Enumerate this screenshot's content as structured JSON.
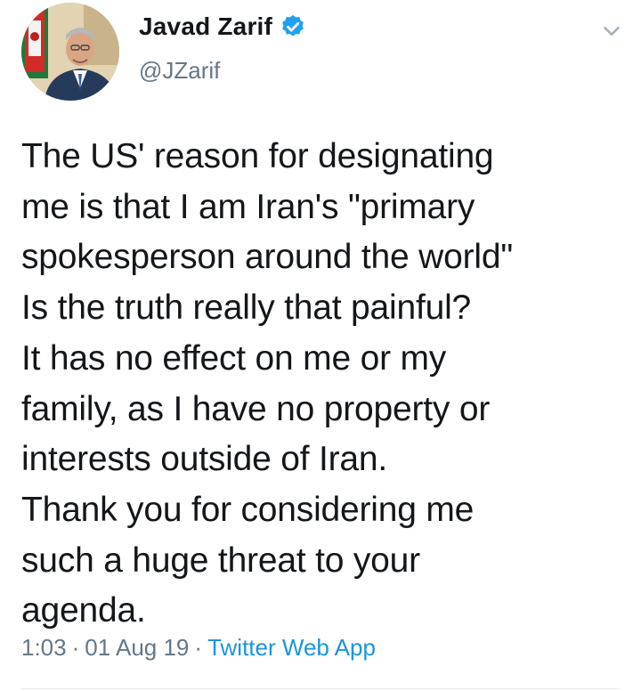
{
  "author": {
    "display_name": "Javad Zarif",
    "handle": "@JZarif",
    "verified": true
  },
  "tweet": {
    "text": "The US' reason for designating\nme is that I am Iran's \"primary\nspokesperson around the world\"\nIs the truth really that painful?\nIt has no effect on me or my\nfamily, as I have no property or\ninterests outside of Iran.\nThank you for considering me\nsuch a huge threat to your\nagenda."
  },
  "meta": {
    "time": "1:03",
    "date": "01 Aug 19",
    "separator": "·",
    "source": "Twitter Web App"
  },
  "icons": {
    "verified": "verified-badge-icon",
    "menu": "chevron-down-icon"
  },
  "colors": {
    "text": "#14171a",
    "secondary": "#657786",
    "link": "#1b95e0",
    "verified": "#1da1f2"
  }
}
